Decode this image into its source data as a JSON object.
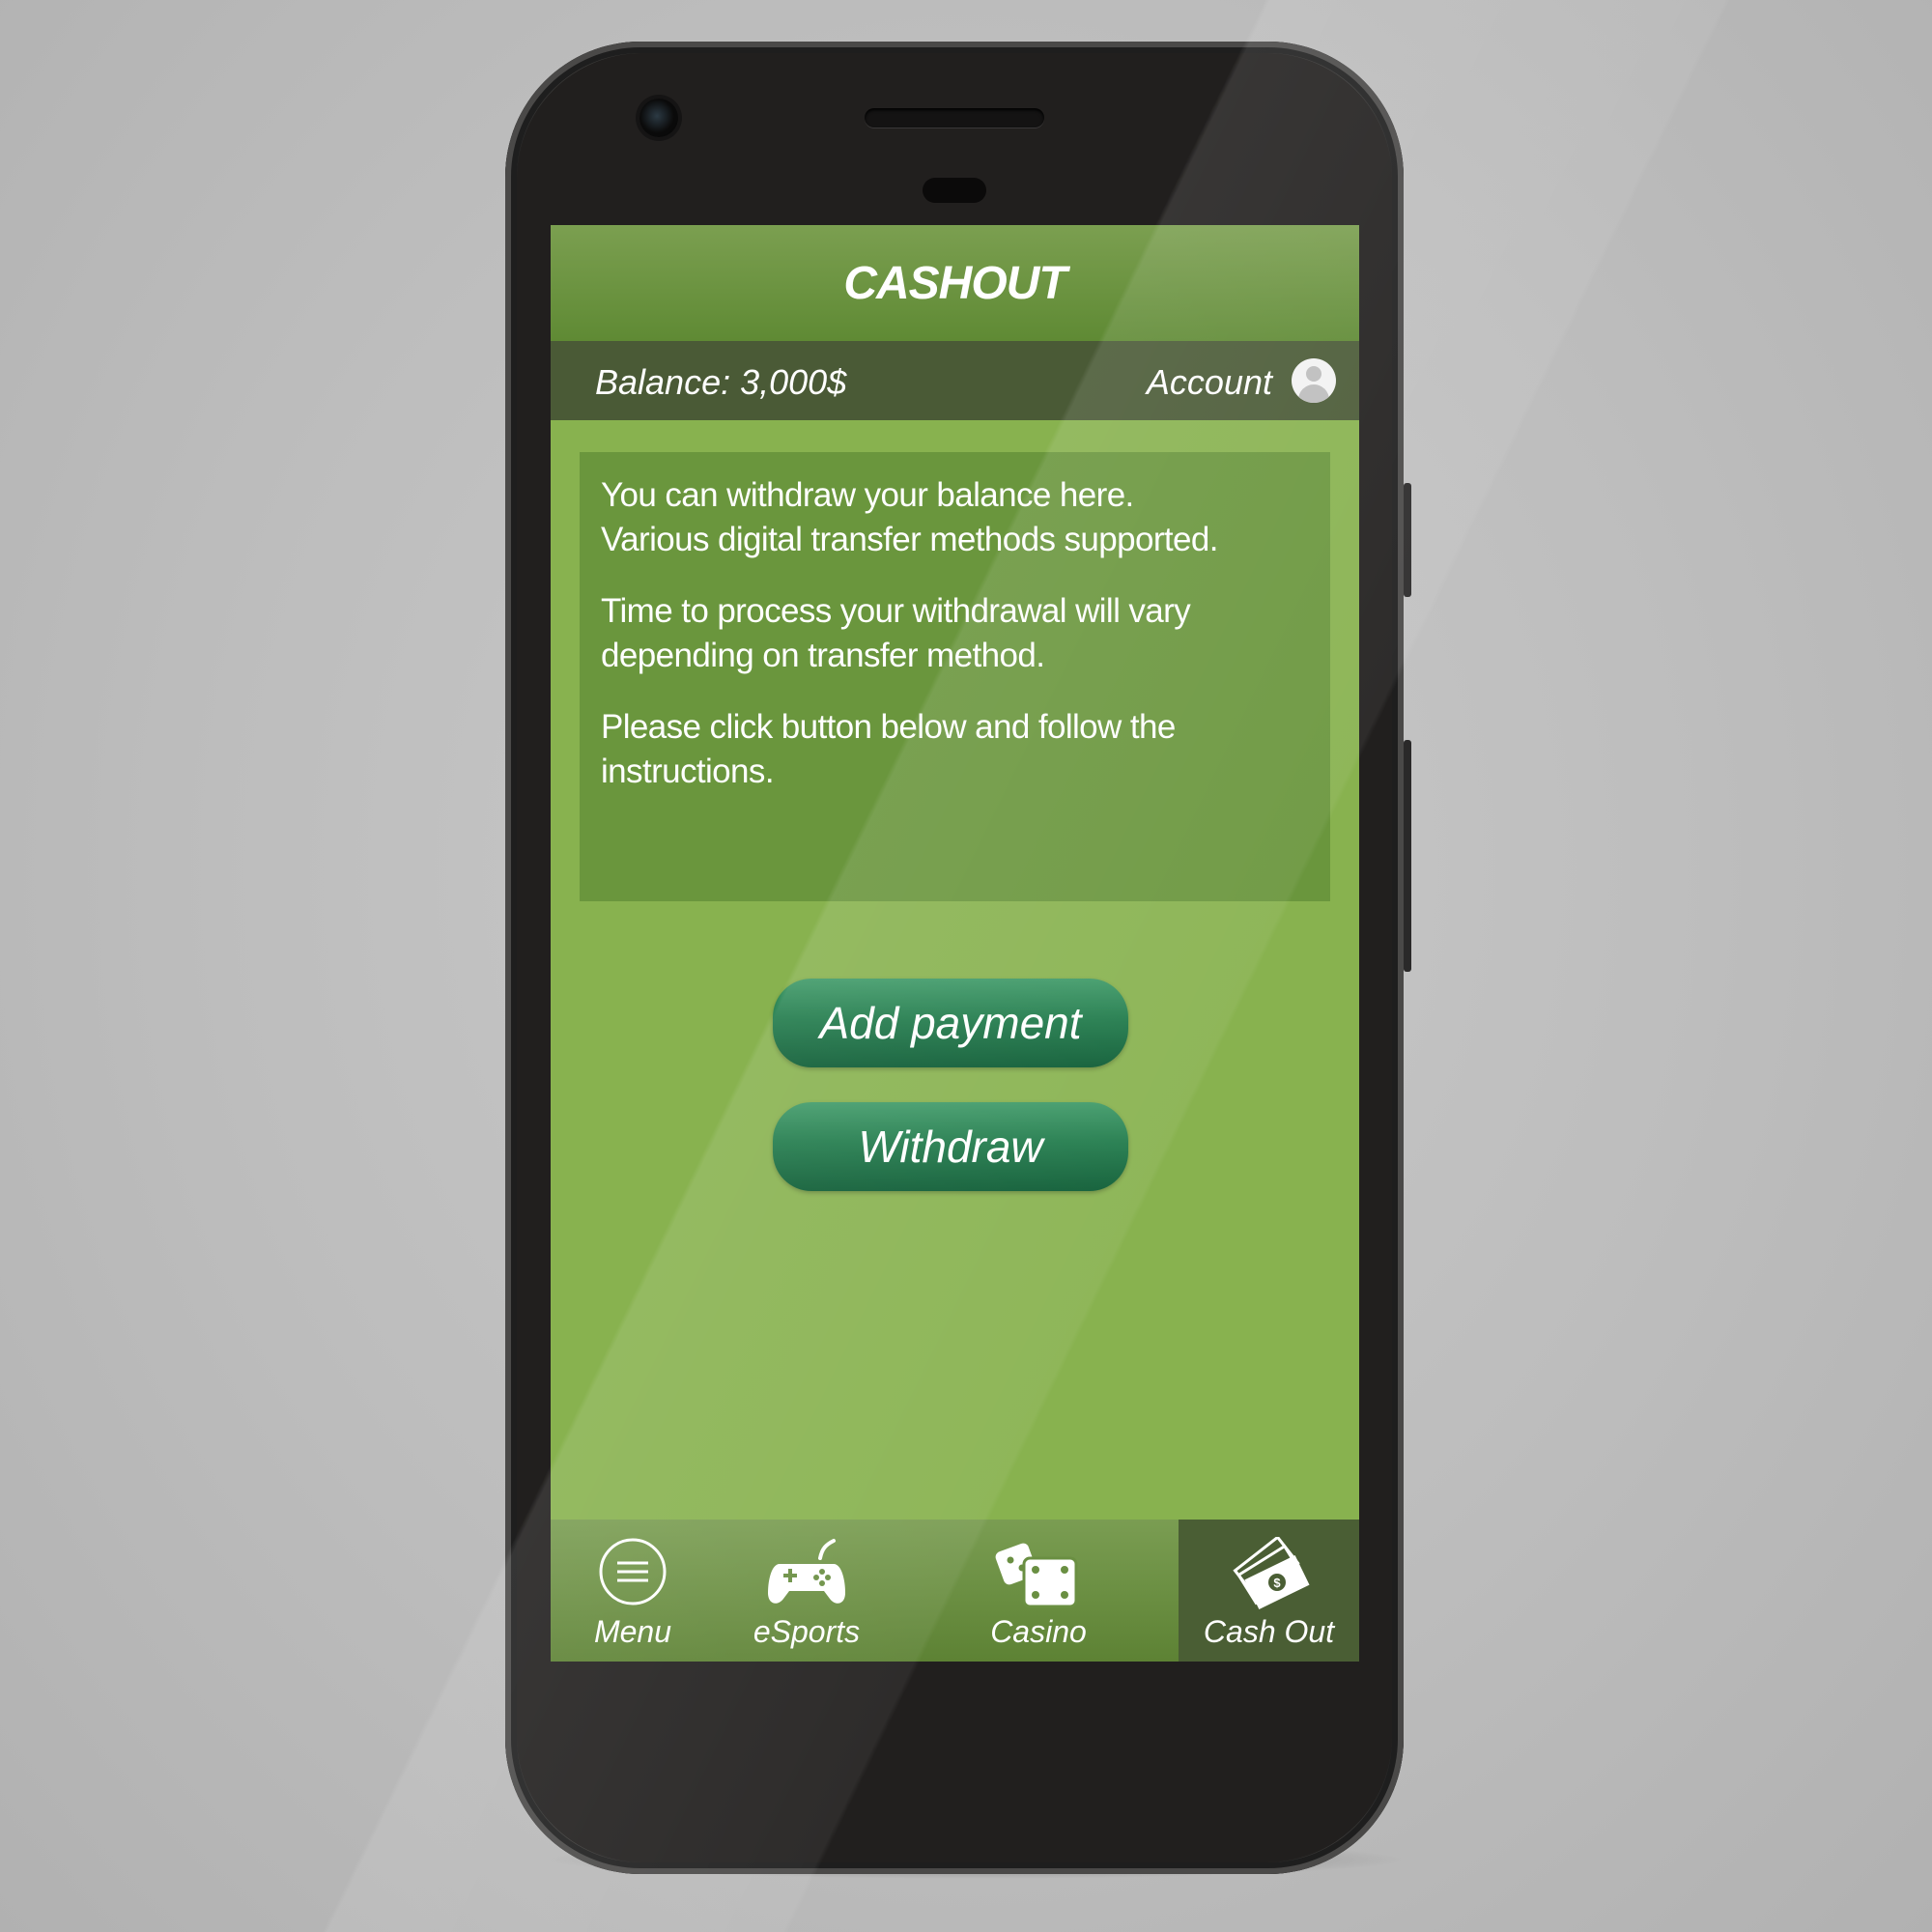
{
  "header": {
    "title": "CASHOUT"
  },
  "balance_bar": {
    "balance": "Balance: 3,000$",
    "account": "Account"
  },
  "info": {
    "paragraph1_line1": "You can withdraw your balance here.",
    "paragraph1_line2": "Various digital transfer methods supported.",
    "paragraph2_line1": "Time to process your withdrawal will vary",
    "paragraph2_line2": "depending on transfer method.",
    "paragraph3_line1": "Please click button below and follow the",
    "paragraph3_line2": "instructions."
  },
  "buttons": {
    "add_payment": "Add payment",
    "withdraw": "Withdraw"
  },
  "nav": {
    "items": [
      {
        "label": "Menu",
        "icon": "menu-icon"
      },
      {
        "label": "eSports",
        "icon": "gamepad-icon"
      },
      {
        "label": "Casino",
        "icon": "dice-icon"
      },
      {
        "label": "Cash Out",
        "icon": "cash-icon",
        "active": true
      }
    ]
  },
  "colors": {
    "screen_bg": "#88b24f",
    "title_bar": "#6b9440",
    "balance_bar": "#4a5a36",
    "info_box": "#6a963d",
    "button": "#1f7a4a",
    "nav_active": "#4a5e34"
  }
}
